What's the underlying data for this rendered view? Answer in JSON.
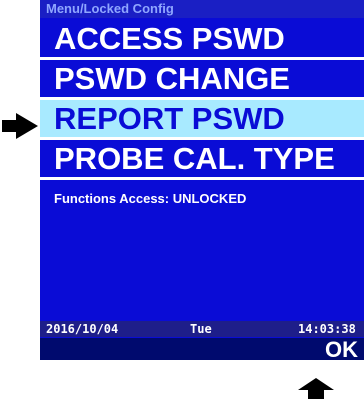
{
  "header": {
    "title": "Menu/Locked Config"
  },
  "menu": {
    "items": [
      {
        "label": "ACCESS PSWD",
        "selected": false
      },
      {
        "label": "PSWD  CHANGE",
        "selected": false
      },
      {
        "label": "REPORT  PSWD",
        "selected": true
      },
      {
        "label": "PROBE  CAL. TYPE",
        "selected": false
      }
    ]
  },
  "status": {
    "text": "Functions Access: UNLOCKED"
  },
  "footer": {
    "date": "2016/10/04",
    "weekday": "Tue",
    "time": "14:03:38"
  },
  "softkey": {
    "ok_label": "OK"
  },
  "colors": {
    "screen_bg": "#0a0cd6",
    "highlight": "#a8eaff",
    "footer_bg": "#1e1e8a",
    "softkey_bg": "#000a6e"
  },
  "icons": {
    "pointer_left": "arrow-right-icon",
    "pointer_bottom": "arrow-up-icon"
  }
}
